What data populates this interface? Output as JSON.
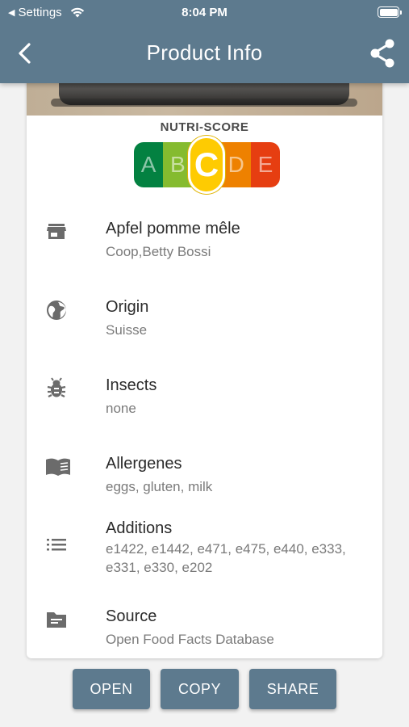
{
  "status_bar": {
    "back_app": "Settings",
    "time": "8:04 PM"
  },
  "header": {
    "title": "Product Info",
    "back_icon": "chevron-left-icon",
    "share_icon": "share-icon"
  },
  "nutri_score": {
    "title": "NUTRI-SCORE",
    "grades": [
      "A",
      "B",
      "C",
      "D",
      "E"
    ],
    "selected": "C",
    "colors": [
      "#038141",
      "#85bb2f",
      "#fecb02",
      "#ee8100",
      "#e63e11"
    ]
  },
  "info": [
    {
      "icon": "store-icon",
      "title": "Apfel pomme mêle",
      "subtitle": "Coop,Betty Bossi"
    },
    {
      "icon": "globe-icon",
      "title": "Origin",
      "subtitle": "Suisse"
    },
    {
      "icon": "bug-icon",
      "title": "Insects",
      "subtitle": "none"
    },
    {
      "icon": "book-icon",
      "title": "Allergenes",
      "subtitle": "eggs, gluten, milk"
    },
    {
      "icon": "list-icon",
      "title": "Additions",
      "subtitle": "e1422, e1442, e471, e475, e440, e333, e331, e330, e202"
    },
    {
      "icon": "folder-icon",
      "title": "Source",
      "subtitle": "Open Food Facts Database"
    }
  ],
  "buttons": {
    "open": "OPEN",
    "copy": "COPY",
    "share": "SHARE"
  },
  "colors": {
    "header": "#5d7a8e",
    "background": "#f2f2f2",
    "icon": "#6b6b6b"
  }
}
